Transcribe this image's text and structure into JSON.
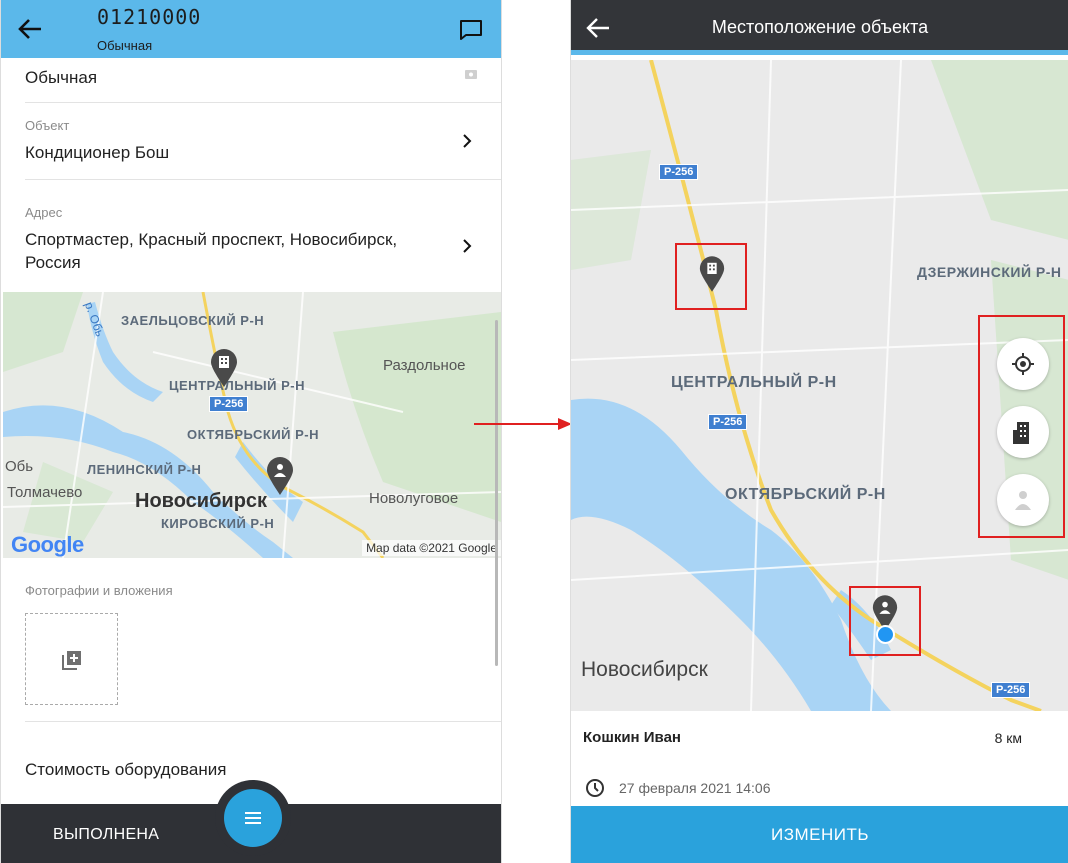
{
  "left": {
    "header": {
      "title": "01210000",
      "subtitle": "Обычная"
    },
    "type_value": "Обычная",
    "object": {
      "label": "Объект",
      "value": "Кондиционер Бош"
    },
    "address": {
      "label": "Адрес",
      "line1": "Спортмастер, Красный проспект, Новосибирск,",
      "line2": "Россия"
    },
    "map": {
      "labels": [
        "ЗАЕЛЬЦОВСКИЙ Р-Н",
        "ЦЕНТРАЛЬНЫЙ Р-Н",
        "ОКТЯБРЬСКИЙ Р-Н",
        "ЛЕНИНСКИЙ Р-Н",
        "КИРОВСКИЙ Р-Н"
      ],
      "cities": [
        "Раздольное",
        "Обь",
        "Толмачево",
        "Новолуговое"
      ],
      "main_city": "Новосибирск",
      "river": "р. Обь",
      "road": "Р-256",
      "google": "Google",
      "mapdata": "Map data ©2021 Google"
    },
    "photos_label": "Фотографии и вложения",
    "cost_label": "Стоимость оборудования",
    "status": "ВЫПОЛНЕНА"
  },
  "right": {
    "header": {
      "title": "Местоположение объекта"
    },
    "map": {
      "labels": [
        "ДЗЕРЖИНСКИЙ Р-Н",
        "ЦЕНТРАЛЬНЫЙ Р-Н",
        "ОКТЯБРЬСКИЙ Р-Н"
      ],
      "main_city": "Новосибирск",
      "road": "Р-256"
    },
    "user_name": "Кошкин Иван",
    "distance": "8 км",
    "datetime": "27 февраля 2021 14:06",
    "button": "ИЗМЕНИТЬ"
  },
  "colors": {
    "accent": "#5bb8ea",
    "fab": "#2aa2dc",
    "dark": "#2f3136",
    "highlight": "#e02020",
    "water": "#a9d4f5"
  },
  "icons": [
    "back-arrow-icon",
    "chat-icon",
    "card-icon",
    "chevron-right-icon",
    "add-photo-icon",
    "menu-icon",
    "building-pin-icon",
    "person-pin-icon",
    "my-location-icon",
    "building-icon",
    "person-icon",
    "clock-icon"
  ]
}
